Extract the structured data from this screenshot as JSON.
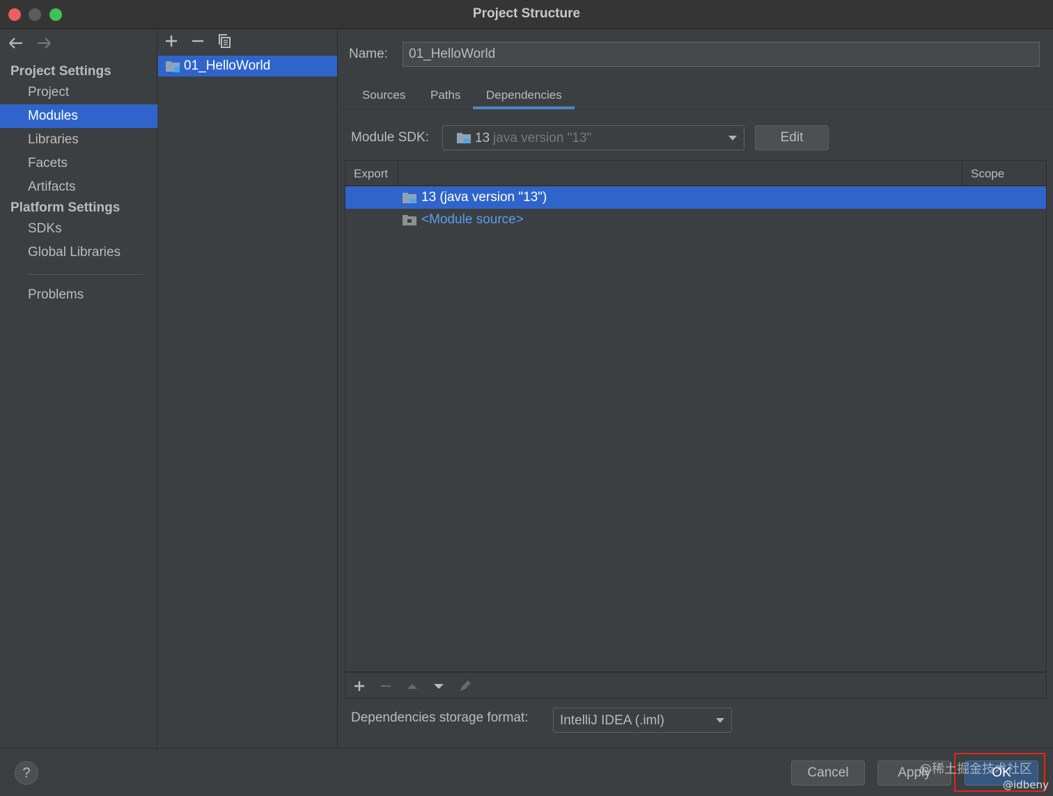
{
  "window": {
    "title": "Project Structure"
  },
  "sidebar": {
    "project_settings_title": "Project Settings",
    "platform_settings_title": "Platform Settings",
    "items": {
      "project": "Project",
      "modules": "Modules",
      "libraries": "Libraries",
      "facets": "Facets",
      "artifacts": "Artifacts",
      "sdks": "SDKs",
      "global_libraries": "Global Libraries",
      "problems": "Problems"
    },
    "selected": "Modules"
  },
  "modules": {
    "items": [
      "01_HelloWorld"
    ],
    "selected": "01_HelloWorld"
  },
  "main": {
    "name_label": "Name:",
    "name_value": "01_HelloWorld",
    "tabs": [
      "Sources",
      "Paths",
      "Dependencies"
    ],
    "active_tab": "Dependencies",
    "module_sdk_label": "Module SDK:",
    "module_sdk_value_main": "13",
    "module_sdk_value_detail": "java version \"13\"",
    "edit_label": "Edit",
    "table": {
      "col_export": "Export",
      "col_scope": "Scope",
      "rows": [
        {
          "label": "13 (java version \"13\")",
          "selected": true
        },
        {
          "label": "<Module source>",
          "selected": false
        }
      ]
    },
    "storage_label": "Dependencies storage format:",
    "storage_value": "IntelliJ IDEA (.iml)"
  },
  "footer": {
    "help": "?",
    "cancel": "Cancel",
    "apply": "Apply",
    "ok": "OK",
    "watermark": "@稀土掘金技术社区",
    "watermark_user": "@idbeny"
  },
  "colors": {
    "selection": "#2f65ca",
    "background": "#3c3f41",
    "link": "#589df6",
    "highlight_box": "#e0251e"
  }
}
